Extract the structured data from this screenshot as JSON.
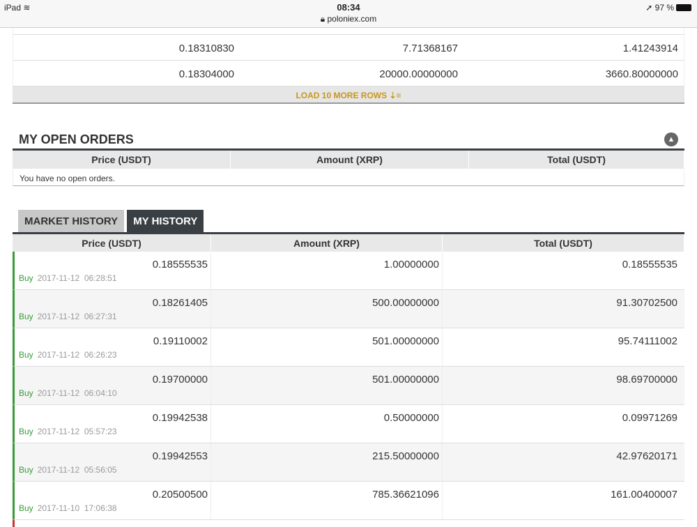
{
  "status_bar": {
    "device": "iPad",
    "time": "08:34",
    "url": "poloniex.com",
    "battery": "97 %"
  },
  "sell_orders": {
    "rows": [
      [
        "0.18310830",
        "7.71368167",
        "1.41243914"
      ],
      [
        "0.18304000",
        "20000.00000000",
        "3660.80000000"
      ]
    ],
    "load_more": "LOAD 10 MORE ROWS"
  },
  "open_orders": {
    "title": "MY OPEN ORDERS",
    "columns": [
      "Price (USDT)",
      "Amount (XRP)",
      "Total (USDT)"
    ],
    "empty": "You have no open orders."
  },
  "history": {
    "tabs": [
      "MARKET HISTORY",
      "MY HISTORY"
    ],
    "active_tab": "MY HISTORY",
    "columns": [
      "Price (USDT)",
      "Amount (XRP)",
      "Total (USDT)"
    ],
    "rows": [
      {
        "type": "Buy",
        "date": "2017-11-12  06:28:51",
        "price": "0.18555535",
        "amount": "1.00000000",
        "total": "0.18555535"
      },
      {
        "type": "Buy",
        "date": "2017-11-12  06:27:31",
        "price": "0.18261405",
        "amount": "500.00000000",
        "total": "91.30702500"
      },
      {
        "type": "Buy",
        "date": "2017-11-12  06:26:23",
        "price": "0.19110002",
        "amount": "501.00000000",
        "total": "95.74111002"
      },
      {
        "type": "Buy",
        "date": "2017-11-12  06:04:10",
        "price": "0.19700000",
        "amount": "501.00000000",
        "total": "98.69700000"
      },
      {
        "type": "Buy",
        "date": "2017-11-12  05:57:23",
        "price": "0.19942538",
        "amount": "0.50000000",
        "total": "0.09971269"
      },
      {
        "type": "Buy",
        "date": "2017-11-12  05:56:05",
        "price": "0.19942553",
        "amount": "215.50000000",
        "total": "42.97620171"
      },
      {
        "type": "Buy",
        "date": "2017-11-10  17:06:38",
        "price": "0.20500500",
        "amount": "785.36621096",
        "total": "161.00400007"
      }
    ]
  }
}
